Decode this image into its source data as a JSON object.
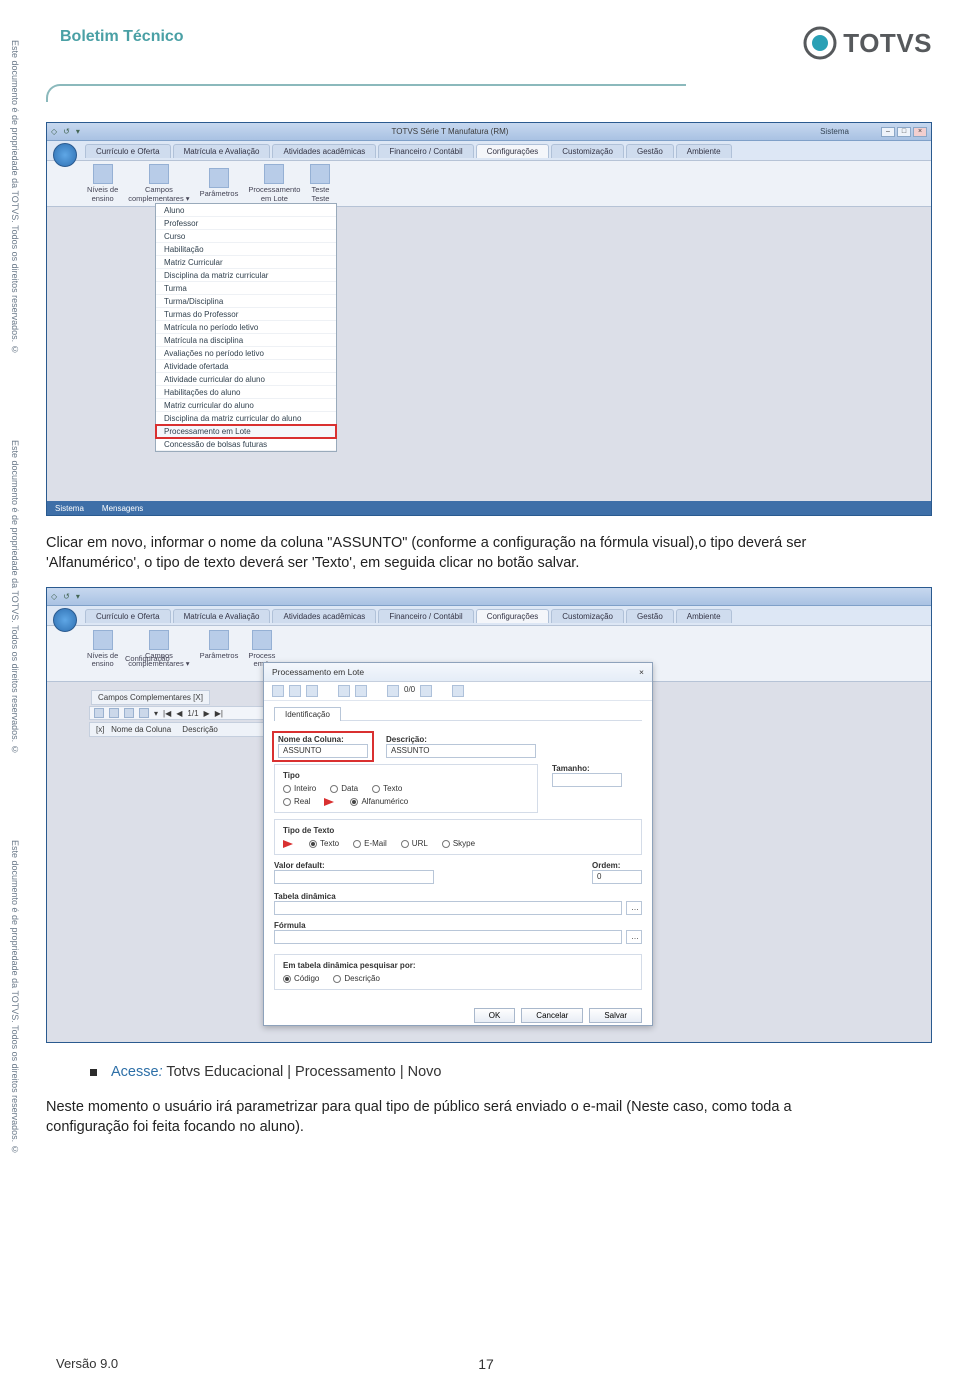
{
  "side_watermark": "Este documento é de propriedade da TOTVS. Todos os direitos reservados. ©",
  "header": {
    "title": "Boletim Técnico",
    "logo_text": "TOTVS"
  },
  "screenshot1": {
    "window_subtitle_right": "Sistema",
    "window_title_center": "TOTVS Série T Manufatura (RM)",
    "tabs": [
      "Currículo e Oferta",
      "Matrícula e Avaliação",
      "Atividades acadêmicas",
      "Financeiro / Contábil",
      "Configurações",
      "Customização",
      "Gestão",
      "Ambiente"
    ],
    "active_tab": "Configurações",
    "ribbon_items": [
      "Níveis de\nensino",
      "Campos\ncomplementares ▾",
      "Parâmetros",
      "Processamento\nem Lote",
      "Teste\nTeste"
    ],
    "dropdown": [
      "Aluno",
      "Professor",
      "Curso",
      "Habilitação",
      "Matriz Curricular",
      "Disciplina da matriz curricular",
      "Turma",
      "Turma/Disciplina",
      "Turmas do Professor",
      "Matrícula no período letivo",
      "Matrícula na disciplina",
      "Avaliações no período letivo",
      "Atividade ofertada",
      "Atividade curricular do aluno",
      "Habilitações do aluno",
      "Matriz curricular do aluno",
      "Disciplina da matriz curricular do aluno",
      "Processamento em Lote",
      "Concessão de bolsas futuras"
    ],
    "highlight_item": "Processamento em Lote",
    "status_left": "Sistema",
    "status_right": "Mensagens"
  },
  "paragraph1_a": "Clicar em novo, informar o nome da coluna \"ASSUNTO\" (conforme a configuração na fórmula visual),o tipo deverá ser",
  "paragraph1_b": "'Alfanumérico', o tipo de texto deverá ser 'Texto', em seguida clicar no botão salvar.",
  "screenshot2": {
    "tabs": [
      "Currículo e Oferta",
      "Matrícula e Avaliação",
      "Atividades acadêmicas",
      "Financeiro / Contábil",
      "Configurações",
      "Customização",
      "Gestão",
      "Ambiente"
    ],
    "ribbon_items": [
      "Níveis de\nensino",
      "Campos\ncomplementares ▾",
      "Parâmetros",
      "Process\nem L"
    ],
    "ribbon_sub": "Configuração",
    "subtab": "Campos Complementares  [X]",
    "toolbar_count": "1/1",
    "grid_header_x": "[x]",
    "grid_header_1": "Nome da Coluna",
    "grid_header_2": "Descrição",
    "dialog": {
      "title": "Processamento em Lote",
      "close": "×",
      "toolbar_text": "0/0",
      "tab": "Identificação",
      "nome_label": "Nome da Coluna:",
      "nome_value": "ASSUNTO",
      "desc_label": "Descrição:",
      "desc_value": "ASSUNTO",
      "tipo_legend": "Tipo",
      "tipo_options": [
        "Inteiro",
        "Data",
        "Texto",
        "Real",
        "Alfanumérico"
      ],
      "tamanho_label": "Tamanho:",
      "tipotexto_legend": "Tipo de Texto",
      "tipotexto_options": [
        "Texto",
        "E-Mail",
        "URL",
        "Skype"
      ],
      "valordefault_label": "Valor default:",
      "ordem_label": "Ordem:",
      "ordem_value": "0",
      "tabela_label": "Tabela dinâmica",
      "formula_label": "Fórmula",
      "pesquisa_label": "Em tabela dinâmica pesquisar por:",
      "pesquisa_options": [
        "Código",
        "Descrição"
      ],
      "btn_ok": "OK",
      "btn_cancel": "Cancelar",
      "btn_save": "Salvar"
    }
  },
  "bullet": {
    "acesse": "Acesse",
    "colon": ":",
    "path": " Totvs Educacional | Processamento | Novo"
  },
  "paragraph2_a": "Neste momento o usuário irá parametrizar para qual tipo de público será enviado  o e-mail (Neste caso, como toda a",
  "paragraph2_b": "configuração foi feita focando no aluno).",
  "footer": {
    "version": "Versão 9.0",
    "page": "17"
  }
}
